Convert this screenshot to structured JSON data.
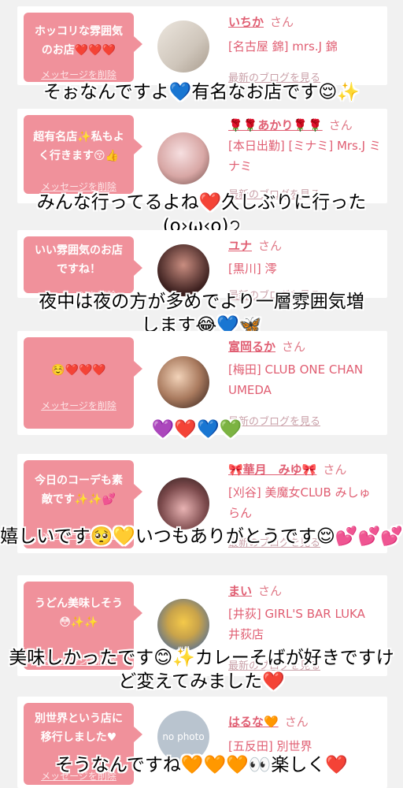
{
  "cards": [
    {
      "bubble_message": "ホッコリな雰囲気のお店❤️❤️❤️",
      "delete_label": "メッセージを削除",
      "user_name": "いちか",
      "honorific": "さん",
      "shop": "[名古屋 錦] mrs.J 錦",
      "blog_link": "最新のブログを見る",
      "overlay": "そぉなんですよ💙有名なお店です😌✨"
    },
    {
      "bubble_message": "超有名店✨私もよく行きます😚👍",
      "delete_label": "メッセージを削除",
      "user_name": "🌹🌹あかり🌹🌹",
      "honorific": "さん",
      "shop": "[本日出勤] [ミナミ] Mrs.J ミナミ",
      "blog_link": "最新のブログを見る",
      "overlay": "みんな行ってるよね❤️久しぶりに行った(o›ω‹o)੭"
    },
    {
      "bubble_message": "いい雰囲気のお店ですね！",
      "delete_label": "メッセージを削除",
      "user_name": "ユナ",
      "honorific": "さん",
      "shop": "[黒川] 澪",
      "blog_link": "最新のブログを見る",
      "overlay": "夜中は夜の方が多めでより一層雰囲気増します😂💙🦋"
    },
    {
      "bubble_message": "☺️❤️❤️❤️",
      "delete_label": "メッセージを削除",
      "user_name": "富岡るか",
      "honorific": "さん",
      "shop": "[梅田] CLUB ONE CHAN UMEDA",
      "blog_link": "最新のブログを見る",
      "overlay": "💜❤️💙💚"
    },
    {
      "bubble_message": "今日のコーデも素敵です✨✨💕",
      "delete_label": "メッセージを削除",
      "user_name": "🎀華月　みゆ🎀",
      "honorific": "さん",
      "shop": "[刈谷] 美魔女CLUB みしゅらん",
      "blog_link": "最新のブログを見る",
      "overlay": "嬉しいです🥺💛いつもありがとうです😌💕💕💕"
    },
    {
      "bubble_message": "うどん美味しそう😳✨✨",
      "delete_label": "メッセージを削除",
      "user_name": "まい",
      "honorific": "さん",
      "shop": "[井荻] GIRL'S BAR LUKA　井荻店",
      "blog_link": "最新のブログを見る",
      "overlay": "美味しかったです😊✨カレーそばが好きですけど変えてみました❤️"
    },
    {
      "bubble_message": "別世界という店に移行しました♥",
      "delete_label": "メッセージを削除",
      "user_name": "はるな🧡",
      "honorific": "さん",
      "shop": "[五反田] 別世界",
      "avatar_text": "no photo",
      "overlay": "そうなんですね🧡🧡🧡👀楽しく❤️"
    }
  ],
  "colors": {
    "bubble": "#f0919b",
    "name": "#e05e72",
    "background": "#f1f1f1"
  }
}
